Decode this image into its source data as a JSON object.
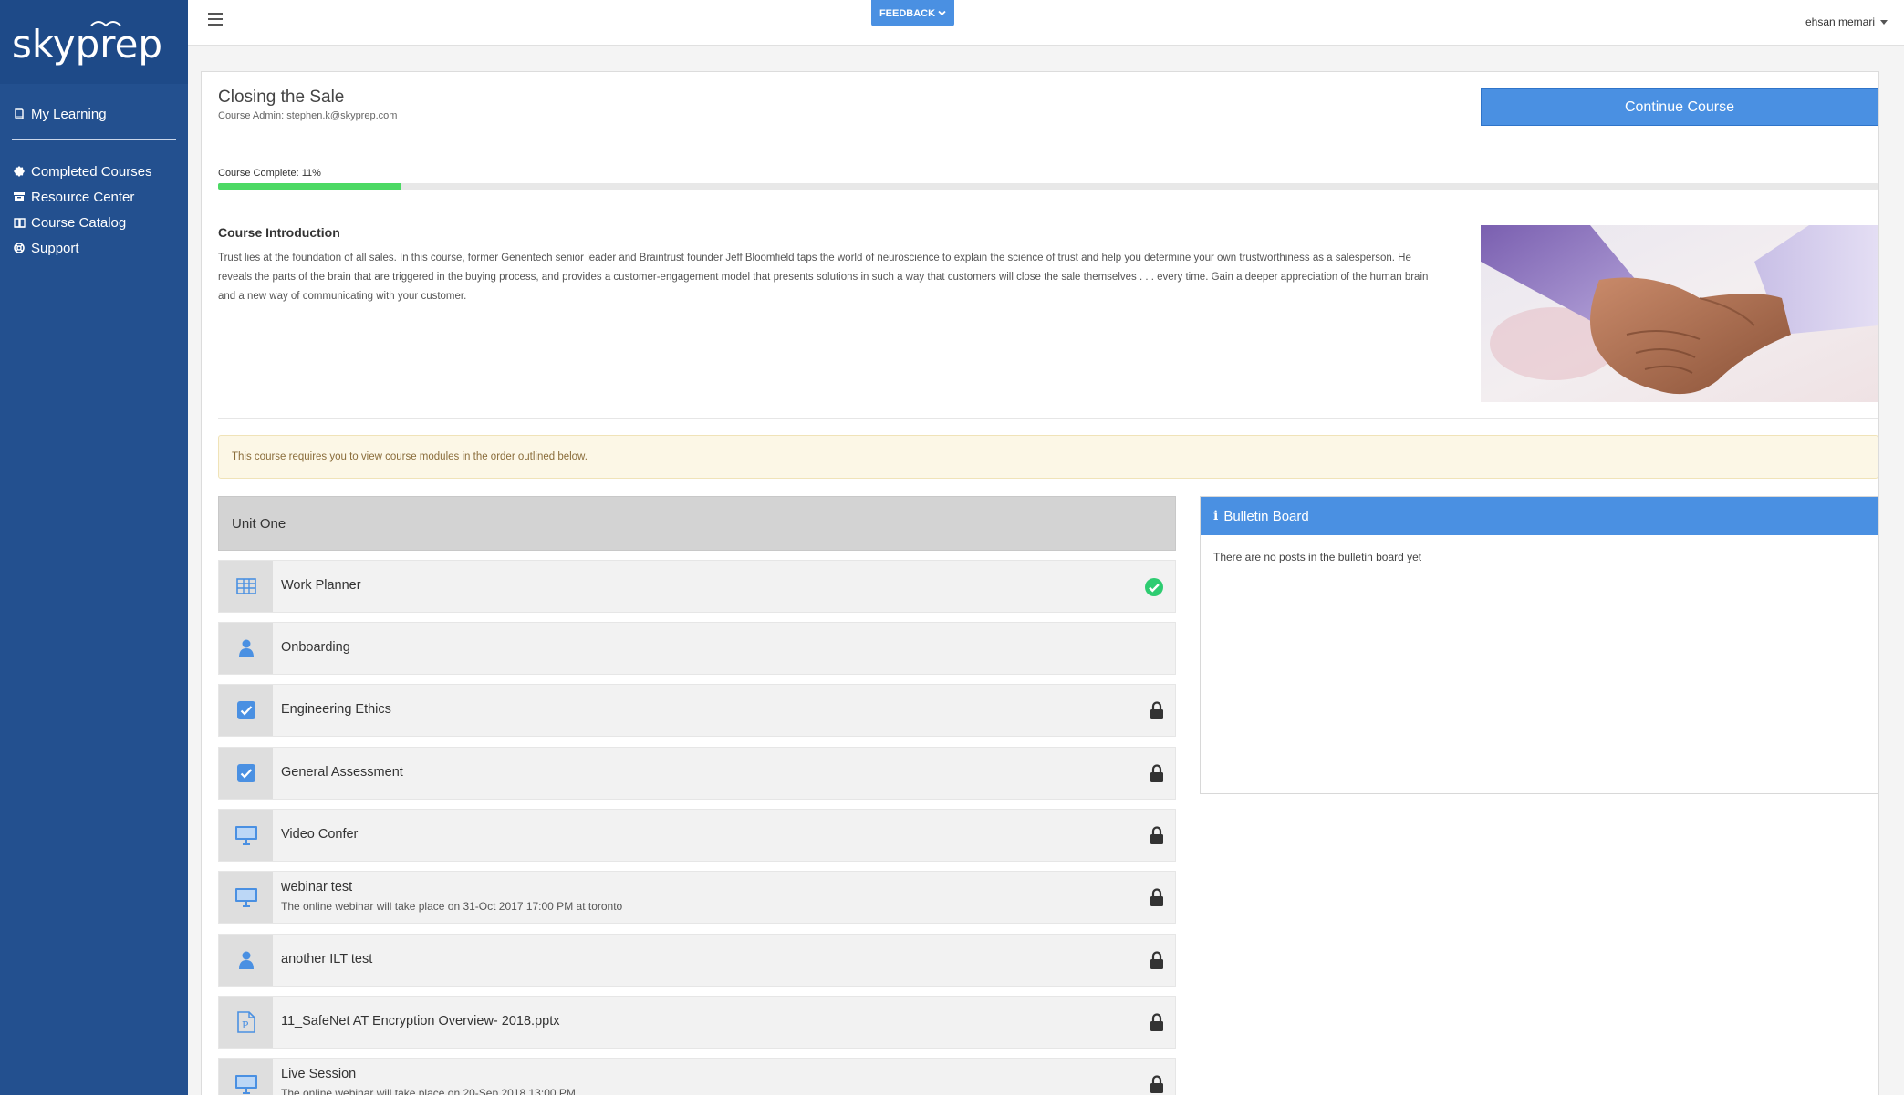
{
  "brand": {
    "logo_text": "skyprep"
  },
  "sidebar": {
    "items": [
      {
        "label": "My Learning",
        "icon": "book-icon"
      },
      {
        "label": "Completed Courses",
        "icon": "badge-icon"
      },
      {
        "label": "Resource Center",
        "icon": "archive-icon"
      },
      {
        "label": "Course Catalog",
        "icon": "catalog-icon"
      },
      {
        "label": "Support",
        "icon": "lifebuoy-icon"
      }
    ]
  },
  "topbar": {
    "feedback_label": "FEEDBACK",
    "user_name": "ehsan memari"
  },
  "course": {
    "title": "Closing the Sale",
    "admin": "Course Admin: stephen.k@skyprep.com",
    "continue_label": "Continue Course",
    "progress_label": "Course Complete: 11%",
    "progress_percent": 11,
    "intro_title": "Course Introduction",
    "intro_text": "Trust lies at the foundation of all sales. In this course, former Genentech senior leader and Braintrust founder Jeff Bloomfield taps the world of neuroscience to explain the science of trust and help you determine your own trustworthiness as a salesperson. He reveals the parts of the brain that are triggered in the buying process, and provides a customer-engagement model that presents solutions in such a way that customers will close the sale themselves . . . every time. Gain a deeper appreciation of the human brain and a new way of communicating with your customer.",
    "notice": "This course requires you to view course modules in the order outlined below."
  },
  "unit": {
    "title": "Unit One"
  },
  "modules": [
    {
      "title": "Work Planner",
      "subtitle": "",
      "icon": "table-icon",
      "status": "completed"
    },
    {
      "title": "Onboarding",
      "subtitle": "",
      "icon": "person-icon",
      "status": "open"
    },
    {
      "title": "Engineering Ethics",
      "subtitle": "",
      "icon": "checkbox-icon",
      "status": "locked"
    },
    {
      "title": "General Assessment",
      "subtitle": "",
      "icon": "checkbox-icon",
      "status": "locked"
    },
    {
      "title": "Video Confer",
      "subtitle": "",
      "icon": "monitor-icon",
      "status": "locked"
    },
    {
      "title": "webinar test",
      "subtitle": "The online webinar will take place on 31-Oct 2017 17:00 PM at toronto",
      "icon": "monitor-icon",
      "status": "locked"
    },
    {
      "title": "another ILT test",
      "subtitle": "",
      "icon": "person-icon",
      "status": "locked"
    },
    {
      "title": "11_SafeNet AT Encryption Overview- 2018.pptx",
      "subtitle": "",
      "icon": "powerpoint-file-icon",
      "status": "locked"
    },
    {
      "title": "Live Session",
      "subtitle": "The online webinar will take place on 20-Sep 2018 13:00 PM",
      "icon": "monitor-icon",
      "status": "locked"
    }
  ],
  "bulletin": {
    "title": "Bulletin Board",
    "empty_text": "There are no posts in the bulletin board yet"
  },
  "colors": {
    "sidebar": "#23508f",
    "accent": "#4a90e2",
    "progress": "#4cd964",
    "success": "#2ecc71",
    "notice_bg": "#fcf7e6"
  }
}
